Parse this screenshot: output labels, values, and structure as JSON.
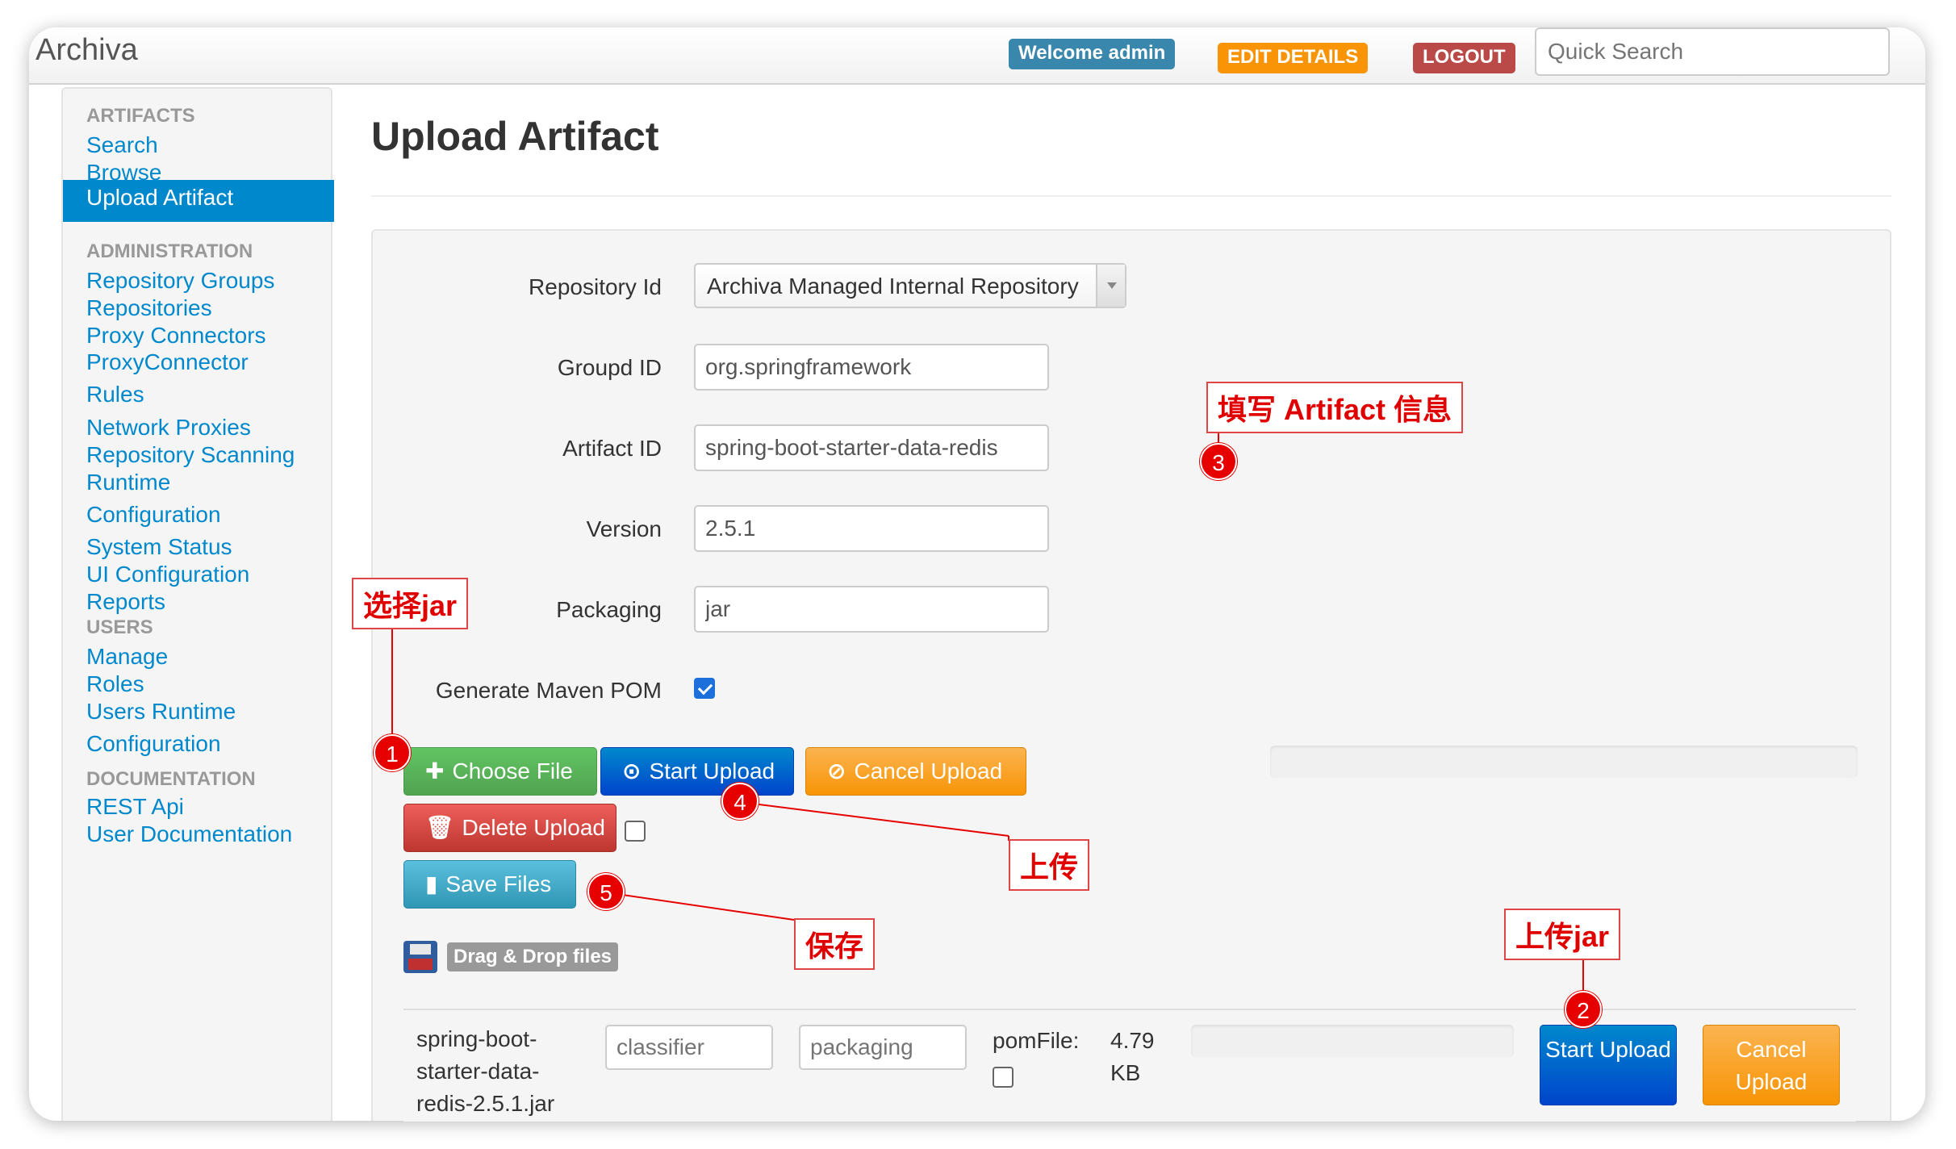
{
  "app": {
    "brand": "Archiva",
    "welcome": "Welcome admin",
    "edit_details": "EDIT DETAILS",
    "logout": "LOGOUT",
    "quick_search_placeholder": "Quick Search"
  },
  "sidebar": {
    "artifacts_header": "ARTIFACTS",
    "search": "Search",
    "browse": "Browse",
    "upload_artifact": "Upload Artifact",
    "administration_header": "ADMINISTRATION",
    "repository_groups": "Repository Groups",
    "repositories": "Repositories",
    "proxy_connectors": "Proxy Connectors",
    "proxy_connector_rules": "ProxyConnector Rules",
    "network_proxies": "Network Proxies",
    "repository_scanning": "Repository Scanning",
    "runtime_configuration": "Runtime Configuration",
    "system_status": "System Status",
    "ui_configuration": "UI Configuration",
    "reports": "Reports",
    "users_header": "USERS",
    "manage": "Manage",
    "roles": "Roles",
    "users_runtime_configuration": "Users Runtime Configuration",
    "documentation_header": "DOCUMENTATION",
    "rest_api": "REST Api",
    "user_documentation": "User Documentation"
  },
  "page": {
    "title": "Upload Artifact"
  },
  "form": {
    "repository_id_label": "Repository Id",
    "repository_id_value": "Archiva Managed Internal Repository",
    "group_id_label": "Groupd ID",
    "group_id_value": "org.springframework",
    "artifact_id_label": "Artifact ID",
    "artifact_id_value": "spring-boot-starter-data-redis",
    "version_label": "Version",
    "version_value": "2.5.1",
    "packaging_label": "Packaging",
    "packaging_value": "jar",
    "generate_pom_label": "Generate Maven POM",
    "generate_pom_checked": true
  },
  "actions": {
    "choose_file": "Choose File",
    "start_upload": "Start Upload",
    "cancel_upload": "Cancel Upload",
    "delete_upload": "Delete Upload",
    "save_files": "Save Files",
    "drag_drop": "Drag & Drop files"
  },
  "file_row": {
    "name": "spring-boot-starter-data-redis-2.5.1.jar",
    "classifier_placeholder": "classifier",
    "packaging_placeholder": "packaging",
    "pom_file_label": "pomFile:",
    "size": "4.79 KB",
    "start_upload": "Start Upload",
    "cancel_upload": "Cancel Upload"
  },
  "annotations": {
    "select_jar": "选择jar",
    "fill_info": "填写 Artifact 信息",
    "upload": "上传",
    "save": "保存",
    "upload_jar": "上传jar",
    "step1": "1",
    "step2": "2",
    "step3": "3",
    "step4": "4",
    "step5": "5",
    "color": "#e60000"
  },
  "colors": {
    "link": "#0088cc",
    "active_nav": "#0088cc",
    "green": "#51a351",
    "blue": "#0044cc",
    "orange": "#f89406",
    "red": "#bd362f",
    "cyan": "#2f96b4"
  }
}
